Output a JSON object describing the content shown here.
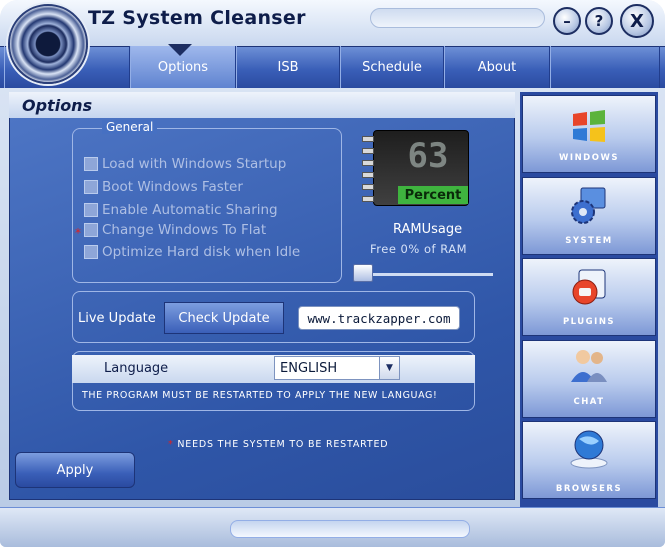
{
  "app": {
    "title": "TZ System Cleanser"
  },
  "window_controls": {
    "minimize": "–",
    "help": "?",
    "close": "X"
  },
  "tabs": [
    {
      "label": "Options",
      "active": true
    },
    {
      "label": "ISB"
    },
    {
      "label": "Schedule"
    },
    {
      "label": "About"
    }
  ],
  "page_title": "Options",
  "general": {
    "legend": "General",
    "options": [
      {
        "label": "Load with Windows Startup"
      },
      {
        "label": "Boot Windows Faster"
      },
      {
        "label": "Enable Automatic Sharing"
      },
      {
        "label": "Change Windows To Flat",
        "needs_restart": true
      },
      {
        "label": "Optimize Hard disk when Idle"
      }
    ],
    "asterisk": "*"
  },
  "ram": {
    "value": "63",
    "badge": "Percent",
    "title": "RAMUsage",
    "free_text": "Free  0% of RAM"
  },
  "live_update": {
    "label": "Live Update",
    "button": "Check Update",
    "url": "www.trackzapper.com"
  },
  "language": {
    "label": "Language",
    "selected": "ENGLISH",
    "note": "THE PROGRAM MUST BE RESTARTED TO APPLY THE NEW LANGUAG!"
  },
  "restart_note": {
    "star": "*",
    "text": "NEEDS THE SYSTEM TO BE RESTARTED"
  },
  "apply_label": "Apply",
  "side_nav": [
    {
      "label": "WINDOWS",
      "icon": "windows-logo-icon"
    },
    {
      "label": "SYSTEM",
      "icon": "system-gear-icon"
    },
    {
      "label": "PLUGINS",
      "icon": "plugins-icon"
    },
    {
      "label": "CHAT",
      "icon": "chat-users-icon"
    },
    {
      "label": "BROWSERS",
      "icon": "browser-globe-icon"
    }
  ],
  "colors": {
    "accent": "#2f56a8",
    "title_text": "#0e1d4a",
    "ram_badge": "#3fb43f",
    "restart_star": "#e02020"
  }
}
